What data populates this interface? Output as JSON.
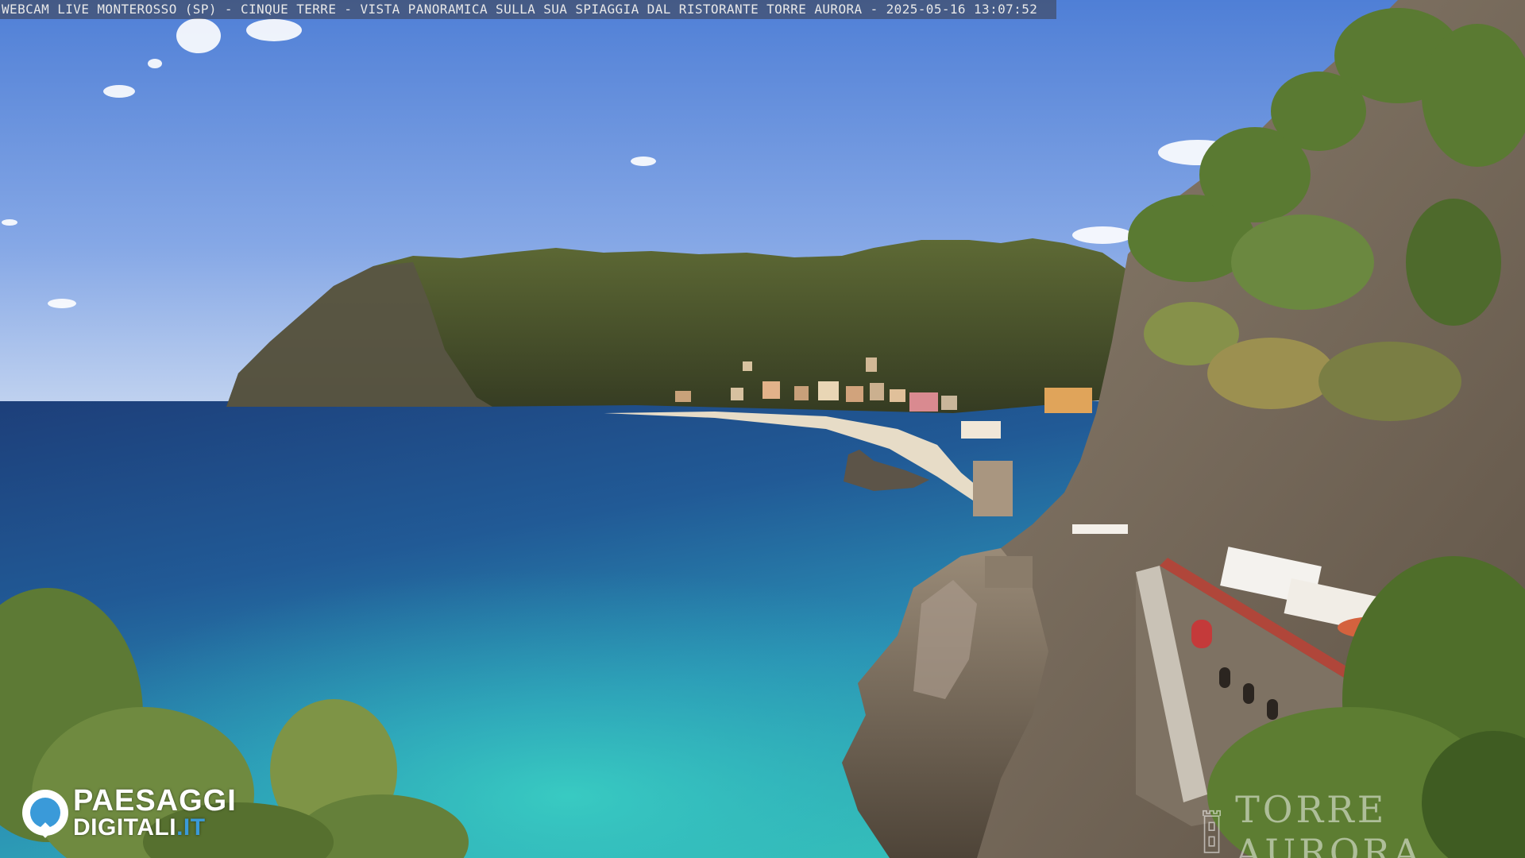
{
  "overlay": {
    "caption": "WEBCAM LIVE MONTEROSSO (SP) - CINQUE TERRE - VISTA PANORAMICA SULLA SUA SPIAGGIA DAL RISTORANTE TORRE AURORA - 2025-05-16 13:07:52"
  },
  "logo": {
    "line1": "PAESAGGI",
    "line2_main": "DIGITALI",
    "line2_tld": ".IT",
    "icon": "camera-pin-icon"
  },
  "watermark": {
    "text": "TORRE AURORA",
    "icon": "tower-icon"
  },
  "colors": {
    "sky_top": "#5a86d6",
    "sky_bottom": "#b9cdee",
    "sea_deep": "#1f4f8a",
    "sea_mid": "#2a78a8",
    "sea_turquoise": "#2fb7b3",
    "hill_green": "#4f5a2c",
    "cliff_rock": "#8a7a66",
    "vegetation": "#5d7a35",
    "logo_accent": "#3a9ad9"
  }
}
